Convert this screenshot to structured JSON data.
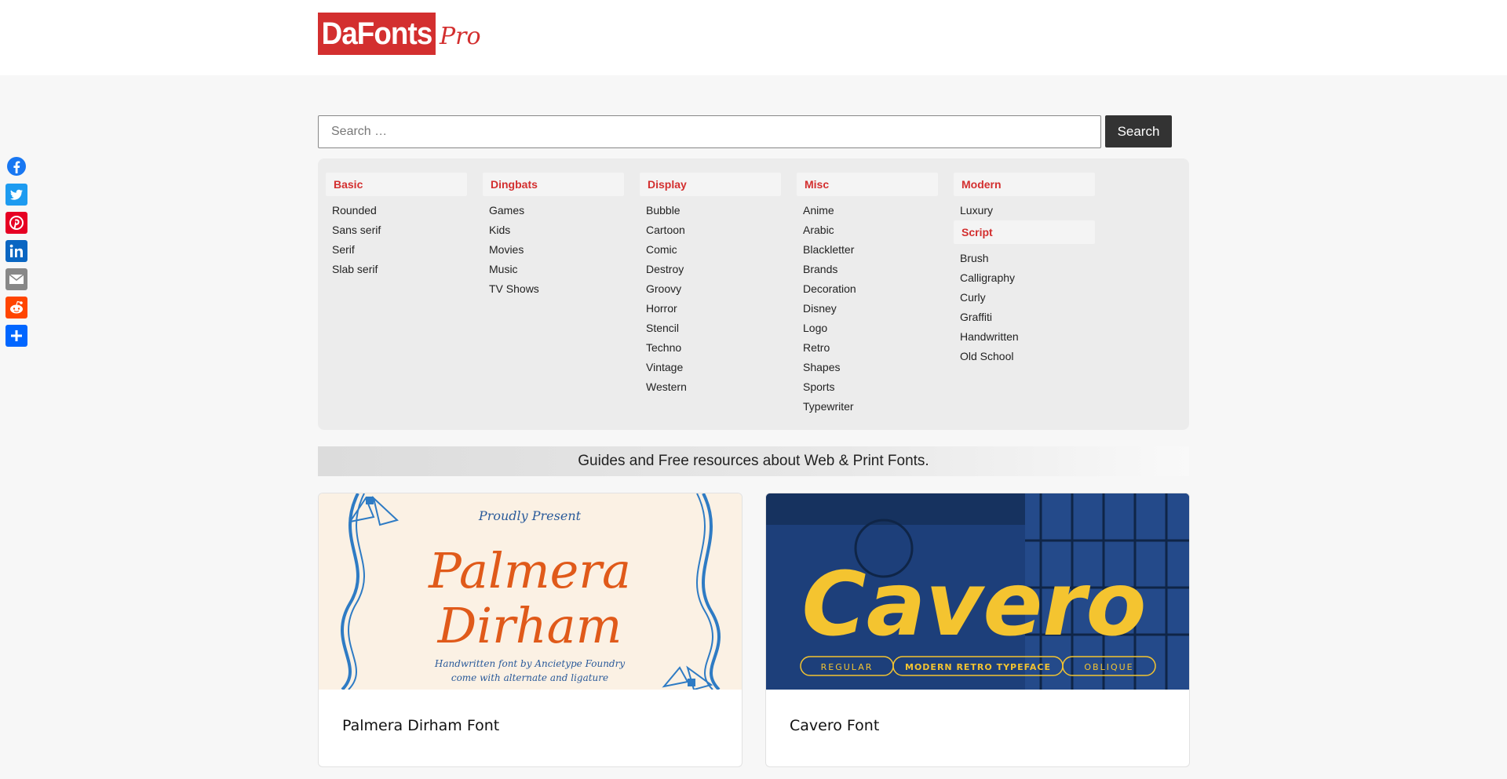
{
  "logo": {
    "brand": "DaFonts",
    "suffix": "Pro"
  },
  "social": [
    "facebook-icon",
    "twitter-icon",
    "pinterest-icon",
    "linkedin-icon",
    "email-icon",
    "reddit-icon",
    "share-icon"
  ],
  "search": {
    "placeholder": "Search …",
    "button_label": "Search"
  },
  "categories": [
    {
      "heading": "Basic",
      "items": [
        "Rounded",
        "Sans serif",
        "Serif",
        "Slab serif"
      ]
    },
    {
      "heading": "Dingbats",
      "items": [
        "Games",
        "Kids",
        "Movies",
        "Music",
        "TV Shows"
      ]
    },
    {
      "heading": "Display",
      "items": [
        "Bubble",
        "Cartoon",
        "Comic",
        "Destroy",
        "Groovy",
        "Horror",
        "Stencil",
        "Techno",
        "Vintage",
        "Western"
      ]
    },
    {
      "heading": "Misc",
      "items": [
        "Anime",
        "Arabic",
        "Blackletter",
        "Brands",
        "Decoration",
        "Disney",
        "Logo",
        "Retro",
        "Shapes",
        "Sports",
        "Typewriter"
      ]
    },
    {
      "heading": "Modern",
      "items": [
        "Luxury"
      ]
    },
    {
      "heading": "Script",
      "items": [
        "Brush",
        "Calligraphy",
        "Curly",
        "Graffiti",
        "Handwritten",
        "Old School"
      ]
    }
  ],
  "banner": "Guides and Free resources about Web & Print Fonts.",
  "cards": [
    {
      "title": "Palmera Dirham Font",
      "image_text": {
        "top": "Proudly Present",
        "line1": "Palmera",
        "line2": "Dirham",
        "sub1": "Handwritten font by Ancietype Foundry",
        "sub2": "come with alternate and ligature"
      }
    },
    {
      "title": "Cavero Font",
      "image_text": {
        "main": "Cavero",
        "pill1": "REGULAR",
        "pill2": "MODERN RETRO TYPEFACE",
        "pill3": "OBLIQUE"
      }
    }
  ],
  "colors": {
    "accent": "#d32f2f",
    "button": "#333333",
    "cavero_yellow": "#f4c430",
    "cavero_blue": "#1d3f7a",
    "palmera_orange": "#e05a1a",
    "palmera_blue": "#2e7bc4"
  }
}
